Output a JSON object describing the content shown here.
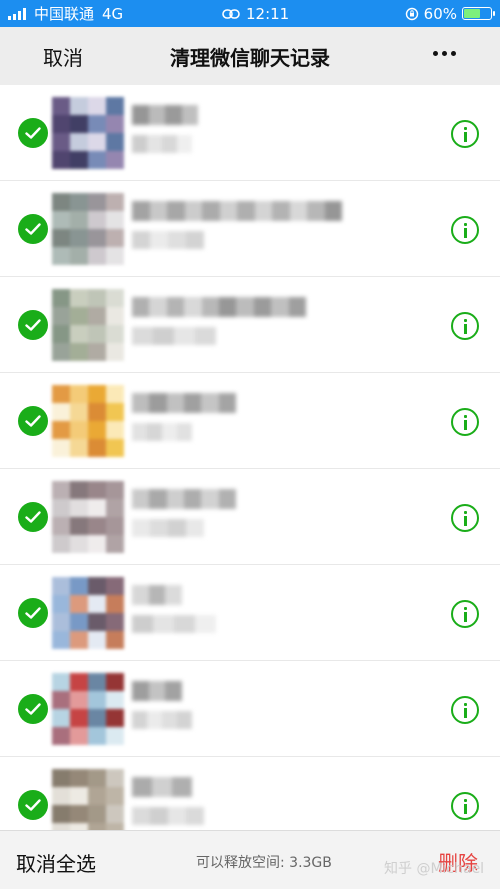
{
  "status_bar": {
    "carrier": "中国联通",
    "network": "4G",
    "time": "12:11",
    "battery_percent": "60%",
    "battery_level": 0.6,
    "color": "#1c8ef0"
  },
  "nav": {
    "cancel_label": "取消",
    "title": "清理微信聊天记录",
    "more_icon": "more-dots-icon",
    "background": "#ededed"
  },
  "list": {
    "row_count": 8,
    "check_icon": "checkmark-circle-icon",
    "info_icon": "info-circle-icon",
    "accent": "#1aad19"
  },
  "bottom_bar": {
    "deselect_all_label": "取消全选",
    "free_space_text": "可以释放空间: 3.3GB",
    "delete_label": "删除",
    "delete_color": "#e64340"
  },
  "watermark": "知乎 @Michael"
}
